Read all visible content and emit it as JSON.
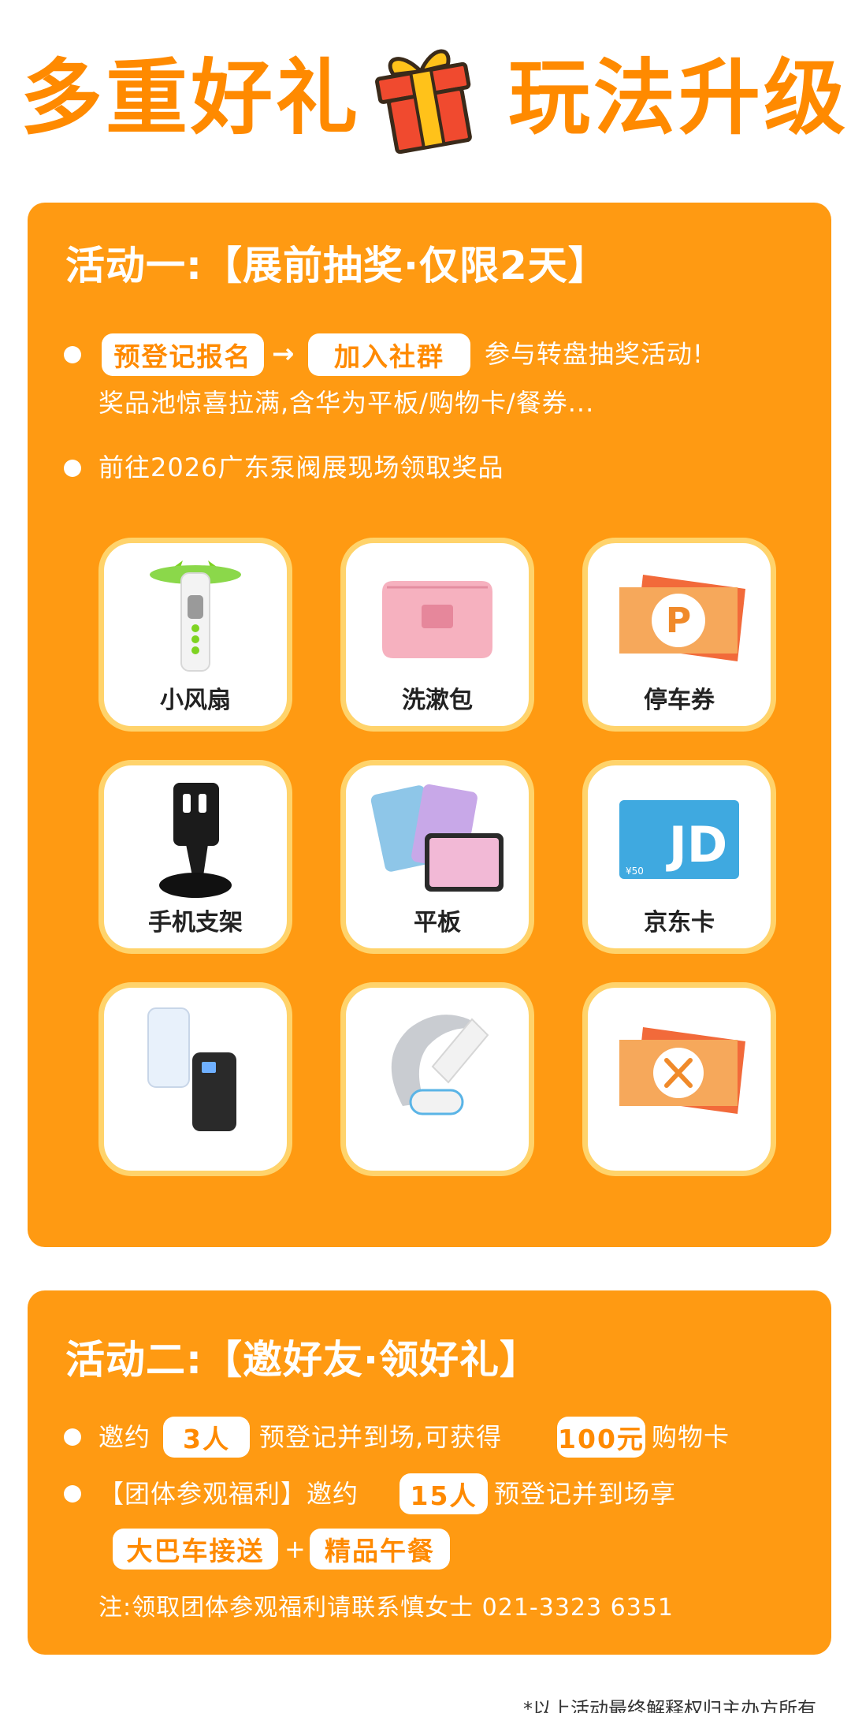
{
  "header": {
    "left_text": "多重好礼",
    "right_text": "玩法升级",
    "icon": "gift-icon",
    "accent_color": "#FF8A00"
  },
  "activity1": {
    "title": "活动一:【展前抽奖·仅限2天】",
    "pill_register": "预登记报名",
    "pill_join": "加入社群",
    "arrow": "→",
    "line1_rest": "参与转盘抽奖活动!",
    "line2": "奖品池惊喜拉满,含华为平板/购物卡/餐券...",
    "line3": "前往2026广东泵阀展现场领取奖品",
    "prizes": [
      {
        "label": "小风扇",
        "icon": "mini-fan-icon"
      },
      {
        "label": "洗漱包",
        "icon": "toiletry-bag-icon"
      },
      {
        "label": "停车券",
        "icon": "parking-ticket-icon"
      },
      {
        "label": "手机支架",
        "icon": "phone-stand-icon"
      },
      {
        "label": "平板",
        "icon": "tablet-icon"
      },
      {
        "label": "京东卡",
        "icon": "jd-card-icon"
      },
      {
        "label": "",
        "icon": "power-bank-icon"
      },
      {
        "label": "",
        "icon": "neck-massager-icon"
      },
      {
        "label": "",
        "icon": "meal-ticket-icon"
      }
    ]
  },
  "activity2": {
    "title": "活动二:【邀好友·领好礼】",
    "invite_prefix": "邀约",
    "invite_count": "3人",
    "invite_mid": "预登记并到场,可获得",
    "reward": "100元",
    "reward_suffix": "购物卡",
    "group_prefix": "【团体参观福利】邀约",
    "group_count": "15人",
    "group_suffix": "预登记并到场享",
    "perk1": "大巴车接送",
    "plus": "+",
    "perk2": "精品午餐",
    "note": "注:领取团体参观福利请联系慎女士 021-3323 6351"
  },
  "footnote": "*以上活动最终解释权归主办方所有"
}
